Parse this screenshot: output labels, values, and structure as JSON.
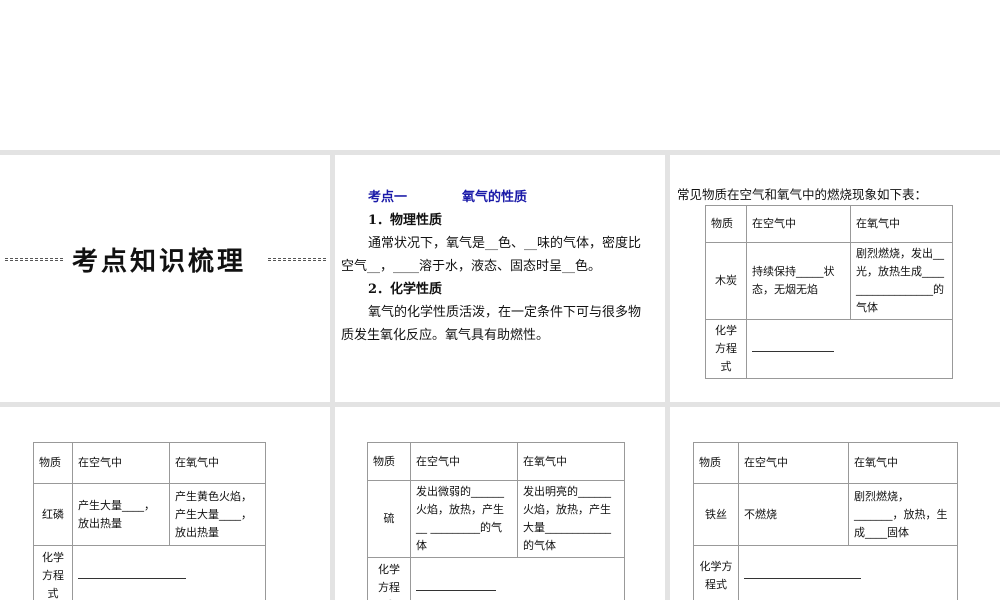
{
  "slide1": {
    "title": "考点知识梳理"
  },
  "slide2": {
    "heading_a": "考点一",
    "heading_b": "氧气的性质",
    "s1": "1．物理性质",
    "p1a": "通常状况下，氧气是__色、__味的气体，密度比",
    "p1b": "空气__，____溶于水，液态、固态时呈__色。",
    "s2": "2．化学性质",
    "p2a": "氧气的化学性质活泼，在一定条件下可与很多物",
    "p2b": "质发生氧化反应。氧气具有助燃性。"
  },
  "headers": {
    "substance": "物质",
    "air": "在空气中",
    "oxygen": "在氧气中",
    "equation": "化学方程式"
  },
  "slide3": {
    "intro": "常见物质在空气和氧气中的燃烧现象如下表：",
    "substance": "木炭",
    "air": "持续保持_____状态，无烟无焰",
    "oxygen": "剧烈燃烧，发出__光，放热生成____ ______________的气体"
  },
  "slide4": {
    "substance": "红磷",
    "air": "产生大量____，放出热量",
    "oxygen": "产生黄色火焰，产生大量____，放出热量"
  },
  "slide5": {
    "substance": "硫",
    "air": "发出微弱的______火焰，放热，产生__ _________的气体",
    "oxygen": "发出明亮的______火焰，放热，产生大量____________的气体"
  },
  "slide6": {
    "substance": "铁丝",
    "air": "不燃烧",
    "oxygen": "剧烈燃烧，_______，放热，生成____固体"
  }
}
